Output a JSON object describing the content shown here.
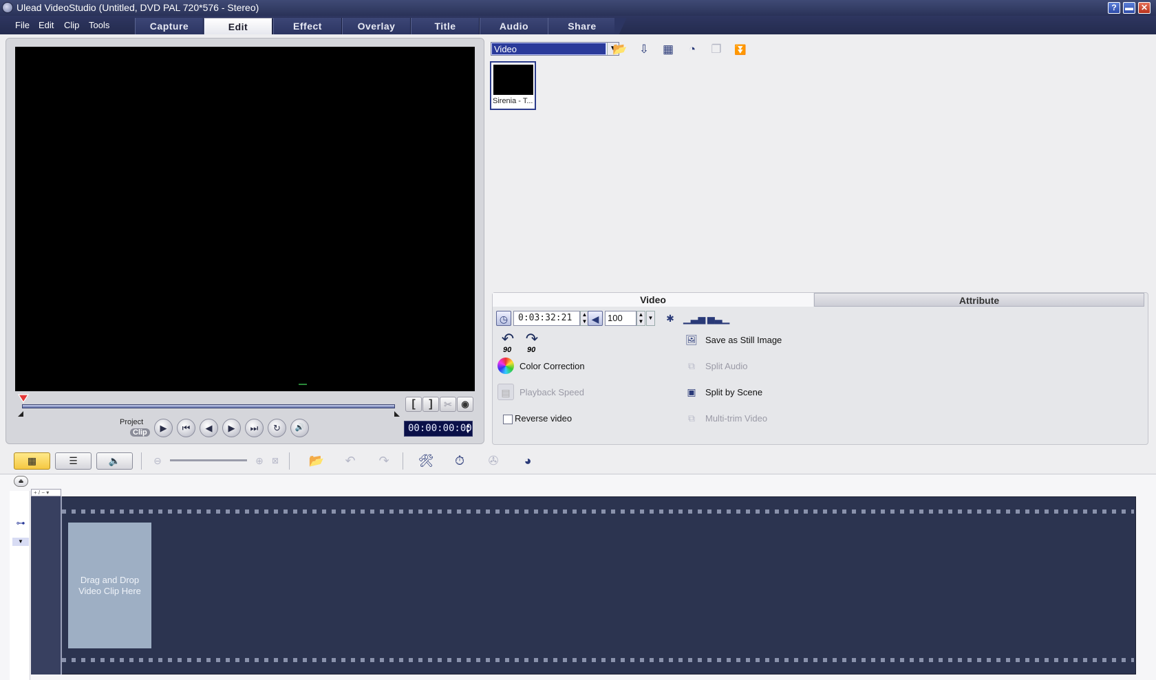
{
  "window": {
    "title": "Ulead VideoStudio (Untitled, DVD PAL 720*576 - Stereo)",
    "help_label": "?",
    "minimize_label": "▬",
    "close_label": "✕"
  },
  "menu": {
    "items": [
      {
        "label": "File"
      },
      {
        "label": "Edit"
      },
      {
        "label": "Clip"
      },
      {
        "label": "Tools"
      }
    ]
  },
  "steps": {
    "tabs": [
      {
        "label": "Capture",
        "active": false
      },
      {
        "label": "Edit",
        "active": true
      },
      {
        "label": "Effect",
        "active": false
      },
      {
        "label": "Overlay",
        "active": false
      },
      {
        "label": "Title",
        "active": false
      },
      {
        "label": "Audio",
        "active": false
      },
      {
        "label": "Share",
        "active": false
      }
    ]
  },
  "preview": {
    "project_label": "Project",
    "clip_label": "Clip",
    "timecode": "00:00:00:00",
    "mark_in_label": "[",
    "mark_out_label": "]",
    "play_icon": "▶",
    "home_icon": "⏮",
    "prev_frame_icon": "◀",
    "next_frame_icon": "▶",
    "end_icon": "⏭",
    "repeat_icon": "↻",
    "volume_icon": "🔊"
  },
  "library": {
    "selected": "Video",
    "dropdown_arrow": "▼",
    "items": [
      {
        "caption": "Sirenia - T..."
      }
    ]
  },
  "options": {
    "tabs": {
      "video": "Video",
      "attribute": "Attribute"
    },
    "duration": "0:03:32:21",
    "volume": "100",
    "rotate_left_label": "90",
    "rotate_right_label": "90",
    "color_correction": "Color Correction",
    "playback_speed": "Playback Speed",
    "reverse_video": "Reverse video",
    "save_still_image": "Save as Still Image",
    "split_audio": "Split Audio",
    "split_by_scene": "Split by Scene",
    "multi_trim_video": "Multi-trim Video"
  },
  "timeline": {
    "drop_hint": "Drag and Drop Video Clip Here",
    "ruler_ctl_label": "+ / − ▾"
  },
  "colors": {
    "titlebar": "#2a3258",
    "storyboard": "#2c3450",
    "drop_slot": "#9eafc4",
    "active_view": "#f5c842"
  }
}
